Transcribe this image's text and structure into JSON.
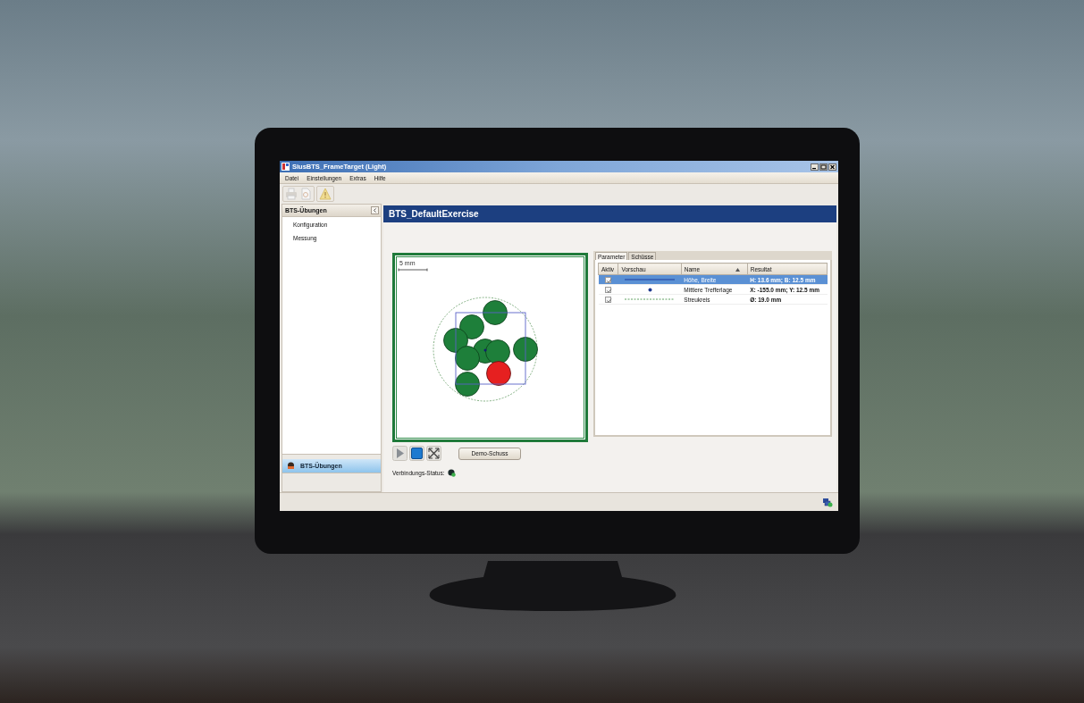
{
  "window": {
    "title": "SiusBTS_FrameTarget (Light)"
  },
  "menu": [
    "Datei",
    "Einstellungen",
    "Extras",
    "Hilfe"
  ],
  "sidebar": {
    "title": "BTS-Übungen",
    "items": [
      "Konfiguration",
      "Messung"
    ],
    "tabs": [
      {
        "label": "BTS-Übungen",
        "selected": true
      }
    ]
  },
  "exercise": {
    "title": "BTS_DefaultExercise",
    "scale_label": "5 mm",
    "demo_button": "Demo-Schuss",
    "status_label": "Verbindungs-Status:"
  },
  "tabs": [
    {
      "label": "Parameter",
      "selected": true
    },
    {
      "label": "Schüsse",
      "selected": false
    }
  ],
  "table": {
    "columns": [
      {
        "label": "Aktiv",
        "sorted": false
      },
      {
        "label": "Vorschau",
        "sorted": false
      },
      {
        "label": "Name",
        "sorted": true
      },
      {
        "label": "Resultat",
        "sorted": false
      }
    ],
    "rows": [
      {
        "checked": true,
        "selected": true,
        "kind": "line",
        "name": "Höhe, Breite",
        "result": "H: 13.6 mm; B: 12.5 mm"
      },
      {
        "checked": true,
        "selected": false,
        "kind": "dot",
        "name": "Mittlere Trefferlage",
        "result": "X: -155.0 mm; Y: 12.5 mm"
      },
      {
        "checked": true,
        "selected": false,
        "kind": "dashed",
        "name": "Streukreis",
        "result": "Ø: 19.0 mm"
      }
    ]
  }
}
